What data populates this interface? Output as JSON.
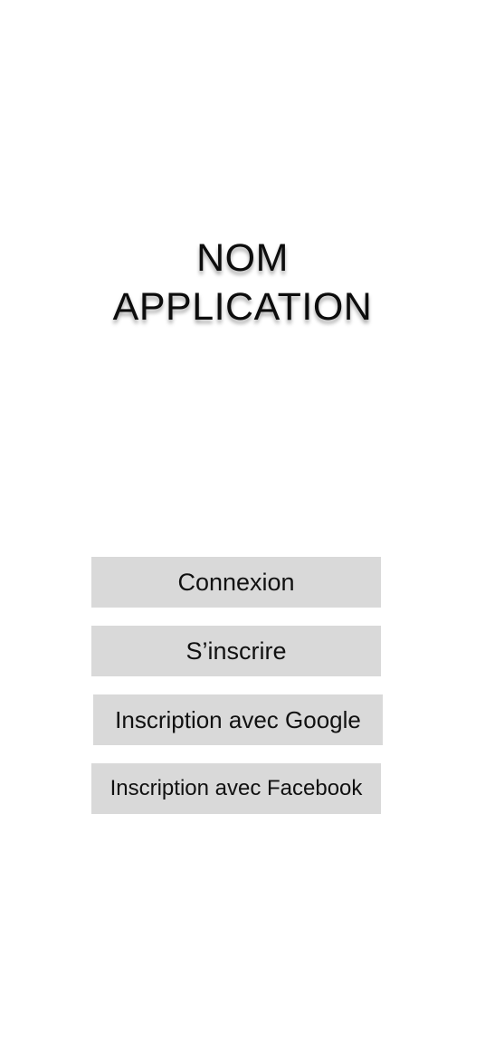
{
  "app": {
    "title_line1": "NOM",
    "title_line2": "APPLICATION"
  },
  "actions": {
    "login_label": "Connexion",
    "signup_label": "S’inscrire",
    "google_signup_label": "Inscription avec Google",
    "facebook_signup_label": "Inscription avec Facebook"
  },
  "colors": {
    "background": "#ffffff",
    "button_background": "#d9d9d9",
    "text": "#111111"
  }
}
